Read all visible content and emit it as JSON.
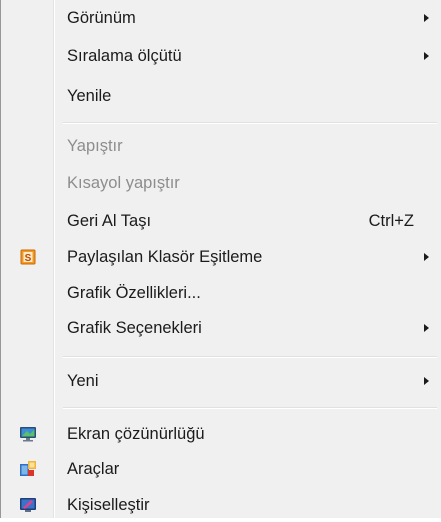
{
  "menu": {
    "items": [
      {
        "label": "Görünüm",
        "has_submenu": true
      },
      {
        "label": "Sıralama ölçütü",
        "has_submenu": true
      },
      {
        "label": "Yenile"
      },
      {
        "label": "Yapıştır",
        "disabled": true
      },
      {
        "label": "Kısayol yapıştır",
        "disabled": true
      },
      {
        "label": "Geri Al Taşı",
        "shortcut": "Ctrl+Z"
      },
      {
        "label": "Paylaşılan Klasör Eşitleme",
        "has_submenu": true,
        "icon": "sync-folder-icon"
      },
      {
        "label": "Grafik Özellikleri..."
      },
      {
        "label": "Grafik Seçenekleri",
        "has_submenu": true
      },
      {
        "label": "Yeni",
        "has_submenu": true
      },
      {
        "label": "Ekran çözünürlüğü",
        "icon": "monitor-icon"
      },
      {
        "label": "Araçlar",
        "icon": "tools-icon"
      },
      {
        "label": "Kişiselleştir",
        "icon": "personalize-icon"
      }
    ]
  }
}
